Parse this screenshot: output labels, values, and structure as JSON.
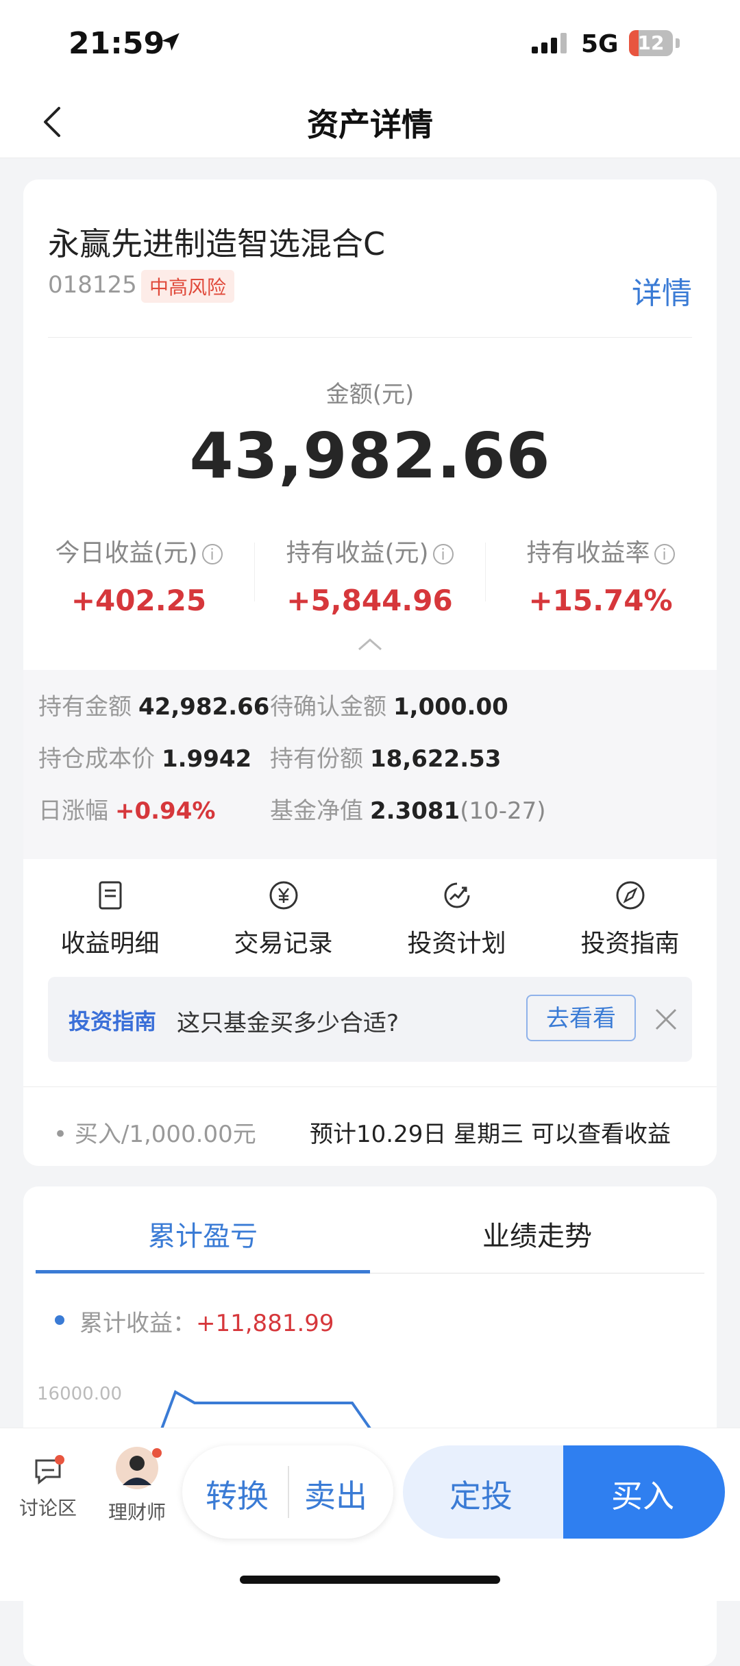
{
  "status_bar": {
    "time": "21:59",
    "network": "5G",
    "battery": "12"
  },
  "nav": {
    "title": "资产详情"
  },
  "fund": {
    "name": "永赢先进制造智选混合C",
    "code": "018125",
    "risk": "中高风险",
    "detail_link": "详情",
    "amount_label": "金额(元)",
    "amount": "43,982.66",
    "stats": [
      {
        "label": "今日收益(元)",
        "value": "+402.25",
        "info": true
      },
      {
        "label": "持有收益(元)",
        "value": "+5,844.96",
        "info": true
      },
      {
        "label": "持有收益率",
        "value": "+15.74%",
        "info": true
      }
    ],
    "details": {
      "hold_amount_label": "持有金额",
      "hold_amount": "42,982.66",
      "pending_label": "待确认金额",
      "pending": "1,000.00",
      "cost_label": "持仓成本价",
      "cost": "1.9942",
      "shares_label": "持有份额",
      "shares": "18,622.53",
      "daily_change_label": "日涨幅",
      "daily_change": "+0.94%",
      "nav_label": "基金净值",
      "nav_value": "2.3081",
      "nav_date": "(10-27)"
    }
  },
  "actions": [
    {
      "label": "收益明细",
      "icon": "document-icon"
    },
    {
      "label": "交易记录",
      "icon": "yuan-icon"
    },
    {
      "label": "投资计划",
      "icon": "trend-icon"
    },
    {
      "label": "投资指南",
      "icon": "compass-icon"
    }
  ],
  "guide": {
    "brand": "投资指南",
    "text": "这只基金买多少合适?",
    "button": "去看看"
  },
  "pending_order": {
    "note": "买入/1,000.00元",
    "estimate": "预计10.29日 星期三 可以查看收益"
  },
  "chart_tabs": {
    "active": "累计盈亏",
    "other": "业绩走势"
  },
  "chart_data": {
    "type": "line",
    "series": [
      {
        "name": "累计收益",
        "values": []
      }
    ],
    "legend_label": "累计收益：",
    "legend_value": "+11,881.99",
    "yticks": [
      "16000.00"
    ]
  },
  "bottom_bar": {
    "discussion": "讨论区",
    "advisor": "理财师",
    "convert": "转换",
    "sell": "卖出",
    "sip": "定投",
    "buy": "买入"
  },
  "colors": {
    "accent": "#3a7bd5",
    "positive": "#d6373b",
    "buy_bg": "#2f7ff0"
  }
}
